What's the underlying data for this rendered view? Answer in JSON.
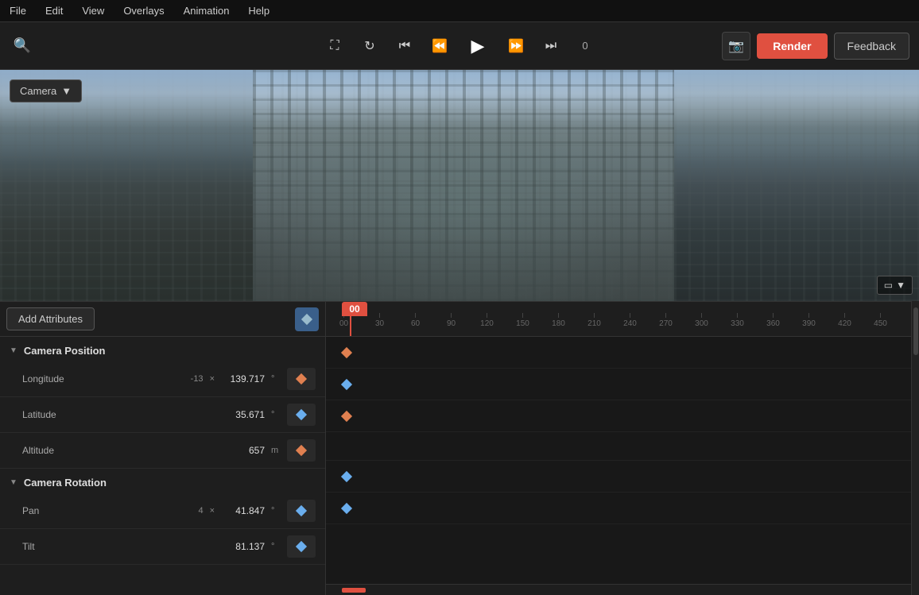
{
  "menu": {
    "items": [
      "File",
      "Edit",
      "View",
      "Overlays",
      "Animation",
      "Help"
    ]
  },
  "toolbar": {
    "search_placeholder": "Search",
    "frame_count": "0",
    "render_label": "Render",
    "feedback_label": "Feedback"
  },
  "viewport": {
    "camera_label": "Camera"
  },
  "attributes": {
    "add_button_label": "Add Attributes",
    "sections": [
      {
        "name": "Camera Position",
        "rows": [
          {
            "label": "Longitude",
            "multiplier": "-13",
            "multiplier_sym": "×",
            "value": "139.717",
            "unit": "°",
            "keyframe_type": "orange"
          },
          {
            "label": "Latitude",
            "multiplier": "",
            "multiplier_sym": "",
            "value": "35.671",
            "unit": "°",
            "keyframe_type": "blue"
          },
          {
            "label": "Altitude",
            "multiplier": "",
            "multiplier_sym": "",
            "value": "657",
            "unit": "m",
            "keyframe_type": "orange"
          }
        ]
      },
      {
        "name": "Camera Rotation",
        "rows": [
          {
            "label": "Pan",
            "multiplier": "4",
            "multiplier_sym": "×",
            "value": "41.847",
            "unit": "°",
            "keyframe_type": "blue"
          },
          {
            "label": "Tilt",
            "multiplier": "",
            "multiplier_sym": "",
            "value": "81.137",
            "unit": "°",
            "keyframe_type": "blue"
          }
        ]
      }
    ]
  },
  "timeline": {
    "playhead_frame": "00",
    "ticks": [
      "00",
      "30",
      "60",
      "90",
      "120",
      "150",
      "180",
      "210",
      "240",
      "270",
      "300",
      "330",
      "360",
      "390",
      "420",
      "450"
    ]
  }
}
